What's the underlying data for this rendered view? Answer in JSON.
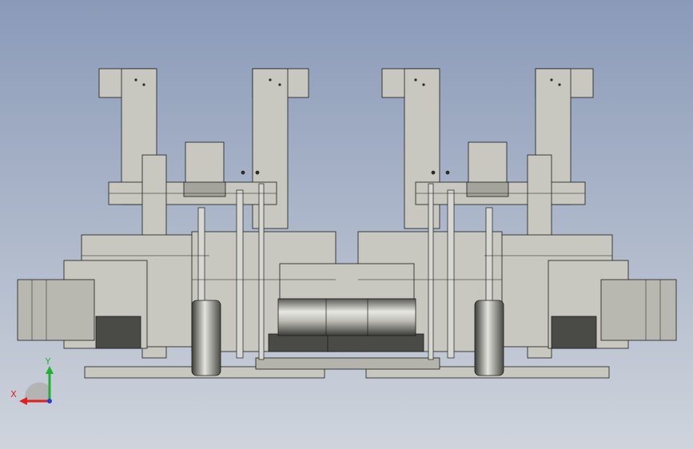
{
  "viewport": {
    "background_top": "#8a9ab8",
    "background_bottom": "#cfd4dc"
  },
  "model": {
    "body_color": "#c8c8c0",
    "shade_color": "#8e8e88",
    "dark_color": "#4a4a46",
    "line_color": "#1c1c1c"
  },
  "triad": {
    "x_label": "X",
    "y_label": "Y",
    "x_color": "#e0201c",
    "y_color": "#20b030",
    "z_color": "#2040d0"
  }
}
